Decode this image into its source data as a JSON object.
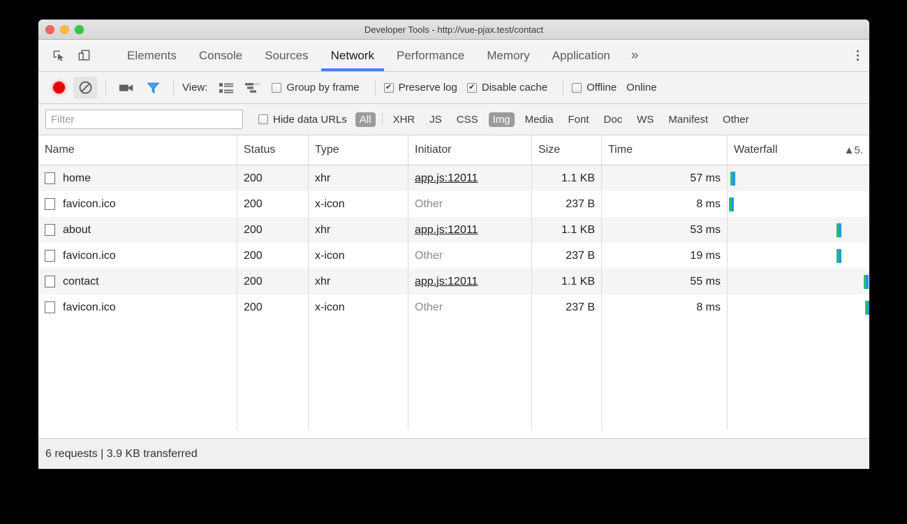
{
  "window": {
    "title": "Developer Tools - http://vue-pjax.test/contact",
    "traffic_lights": [
      "close",
      "minimize",
      "zoom"
    ]
  },
  "accent_color": "#4285f4",
  "tabbar": {
    "inspect_icon": "inspect-element-icon",
    "device_icon": "device-toolbar-icon",
    "tabs": [
      {
        "label": "Elements",
        "selected": false
      },
      {
        "label": "Console",
        "selected": false
      },
      {
        "label": "Sources",
        "selected": false
      },
      {
        "label": "Network",
        "selected": true
      },
      {
        "label": "Performance",
        "selected": false
      },
      {
        "label": "Memory",
        "selected": false
      },
      {
        "label": "Application",
        "selected": false
      }
    ],
    "more_label": "»",
    "menu_icon": "kebab-menu-icon"
  },
  "toolbar": {
    "record_icon": "record-icon",
    "clear_icon": "clear-icon",
    "camera_icon": "camera-icon",
    "filter_icon": "filter-funnel-icon",
    "view_label": "View:",
    "list_view_icon": "list-view-icon",
    "waterfall_view_icon": "waterfall-view-icon",
    "group_by_frame": {
      "label": "Group by frame",
      "checked": false
    },
    "preserve_log": {
      "label": "Preserve log",
      "checked": true
    },
    "disable_cache": {
      "label": "Disable cache",
      "checked": true
    },
    "offline": {
      "label": "Offline",
      "checked": false
    },
    "online_label": "Online"
  },
  "filterbar": {
    "input_value": "",
    "input_placeholder": "Filter",
    "hide_data_urls": {
      "label": "Hide data URLs",
      "checked": false
    },
    "types": [
      {
        "label": "All",
        "active": true
      },
      {
        "label": "XHR",
        "active": false
      },
      {
        "label": "JS",
        "active": false
      },
      {
        "label": "CSS",
        "active": false
      },
      {
        "label": "Img",
        "active": true
      },
      {
        "label": "Media",
        "active": false
      },
      {
        "label": "Font",
        "active": false
      },
      {
        "label": "Doc",
        "active": false
      },
      {
        "label": "WS",
        "active": false
      },
      {
        "label": "Manifest",
        "active": false
      },
      {
        "label": "Other",
        "active": false
      }
    ]
  },
  "table": {
    "columns": [
      "Name",
      "Status",
      "Type",
      "Initiator",
      "Size",
      "Time",
      "Waterfall"
    ],
    "waterfall_sort_indicator": "▲5.",
    "rows": [
      {
        "name": "home",
        "status": "200",
        "type": "xhr",
        "initiator": "app.js:12011",
        "initiator_link": true,
        "size": "1.1 KB",
        "time": "57 ms",
        "bar_left_pct": 2
      },
      {
        "name": "favicon.ico",
        "status": "200",
        "type": "x-icon",
        "initiator": "Other",
        "initiator_link": false,
        "size": "237 B",
        "time": "8 ms",
        "bar_left_pct": 1
      },
      {
        "name": "about",
        "status": "200",
        "type": "xhr",
        "initiator": "app.js:12011",
        "initiator_link": true,
        "size": "1.1 KB",
        "time": "53 ms",
        "bar_left_pct": 77
      },
      {
        "name": "favicon.ico",
        "status": "200",
        "type": "x-icon",
        "initiator": "Other",
        "initiator_link": false,
        "size": "237 B",
        "time": "19 ms",
        "bar_left_pct": 77
      },
      {
        "name": "contact",
        "status": "200",
        "type": "xhr",
        "initiator": "app.js:12011",
        "initiator_link": true,
        "size": "1.1 KB",
        "time": "55 ms",
        "bar_left_pct": 96
      },
      {
        "name": "favicon.ico",
        "status": "200",
        "type": "x-icon",
        "initiator": "Other",
        "initiator_link": false,
        "size": "237 B",
        "time": "8 ms",
        "bar_left_pct": 97
      }
    ]
  },
  "footer": {
    "summary": "6 requests | 3.9 KB transferred"
  }
}
